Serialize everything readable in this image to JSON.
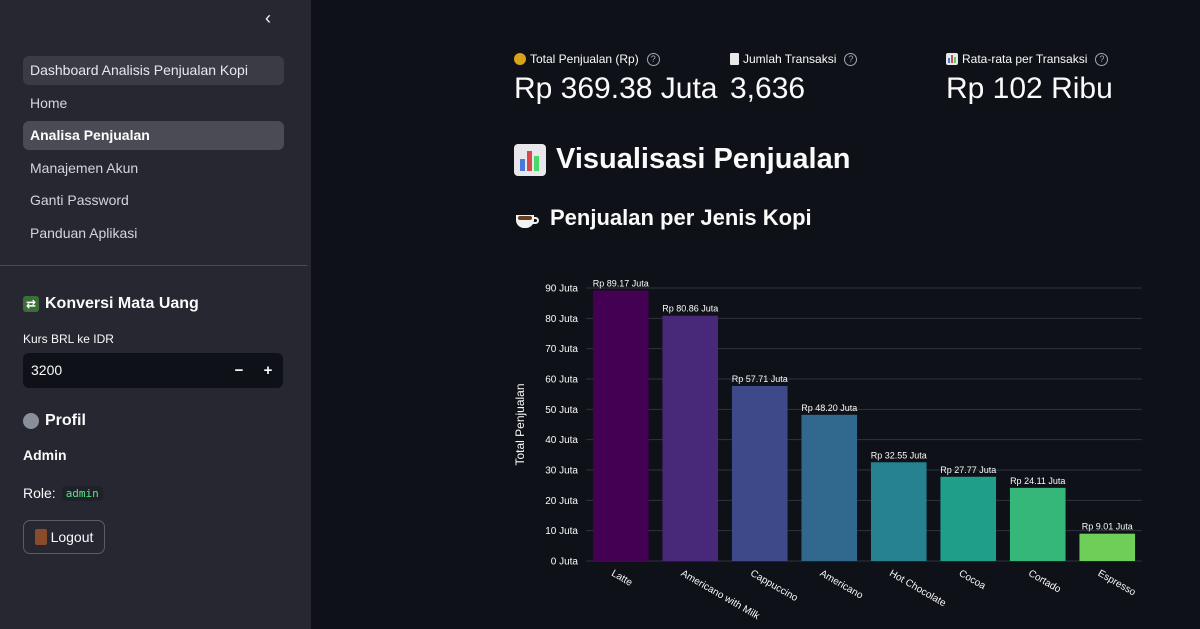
{
  "sidebar": {
    "nav": [
      {
        "label": "Dashboard Analisis Penjualan Kopi"
      },
      {
        "label": "Home"
      },
      {
        "label": "Analisa Penjualan"
      },
      {
        "label": "Manajemen Akun"
      },
      {
        "label": "Ganti Password"
      },
      {
        "label": "Panduan Aplikasi"
      }
    ],
    "converter_title": "Konversi Mata Uang",
    "rate_label": "Kurs BRL ke IDR",
    "rate_value": "3200",
    "minus_label": "−",
    "plus_label": "+",
    "profile_title": "Profil",
    "user_name": "Admin",
    "role_label": "Role:",
    "role_value": "admin",
    "logout_label": "Logout"
  },
  "metrics": [
    {
      "label": "Total Penjualan (Rp)",
      "value": "Rp 369.38 Juta",
      "icon": "money-bag-icon"
    },
    {
      "label": "Jumlah Transaksi",
      "value": "3,636",
      "icon": "receipt-icon"
    },
    {
      "label": "Rata-rata per Transaksi",
      "value": "Rp 102 Ribu",
      "icon": "bar-chart-icon"
    }
  ],
  "section_title": "Visualisasi Penjualan",
  "subsection_title": "Penjualan per Jenis Kopi",
  "chart_data": {
    "type": "bar",
    "ylabel": "Total Penjualan",
    "xlabel": "",
    "ylim": [
      0,
      90
    ],
    "unit": "Juta",
    "yticks": [
      0,
      10,
      20,
      30,
      40,
      50,
      60,
      70,
      80,
      90
    ],
    "ytick_labels": [
      "0 Juta",
      "10 Juta",
      "20 Juta",
      "30 Juta",
      "40 Juta",
      "50 Juta",
      "60 Juta",
      "70 Juta",
      "80 Juta",
      "90 Juta"
    ],
    "categories": [
      "Latte",
      "Americano with Milk",
      "Cappuccino",
      "Americano",
      "Hot Chocolate",
      "Cocoa",
      "Cortado",
      "Espresso"
    ],
    "values": [
      89.17,
      80.86,
      57.71,
      48.2,
      32.55,
      27.77,
      24.11,
      9.01
    ],
    "data_labels": [
      "Rp 89.17 Juta",
      "Rp 80.86 Juta",
      "Rp 57.71 Juta",
      "Rp 48.20 Juta",
      "Rp 32.55 Juta",
      "Rp 27.77 Juta",
      "Rp 24.11 Juta",
      "Rp 9.01 Juta"
    ],
    "colors": [
      "#440154",
      "#482878",
      "#3e4989",
      "#31688e",
      "#26828e",
      "#1f9e89",
      "#35b779",
      "#6ece58"
    ],
    "grid": true
  }
}
